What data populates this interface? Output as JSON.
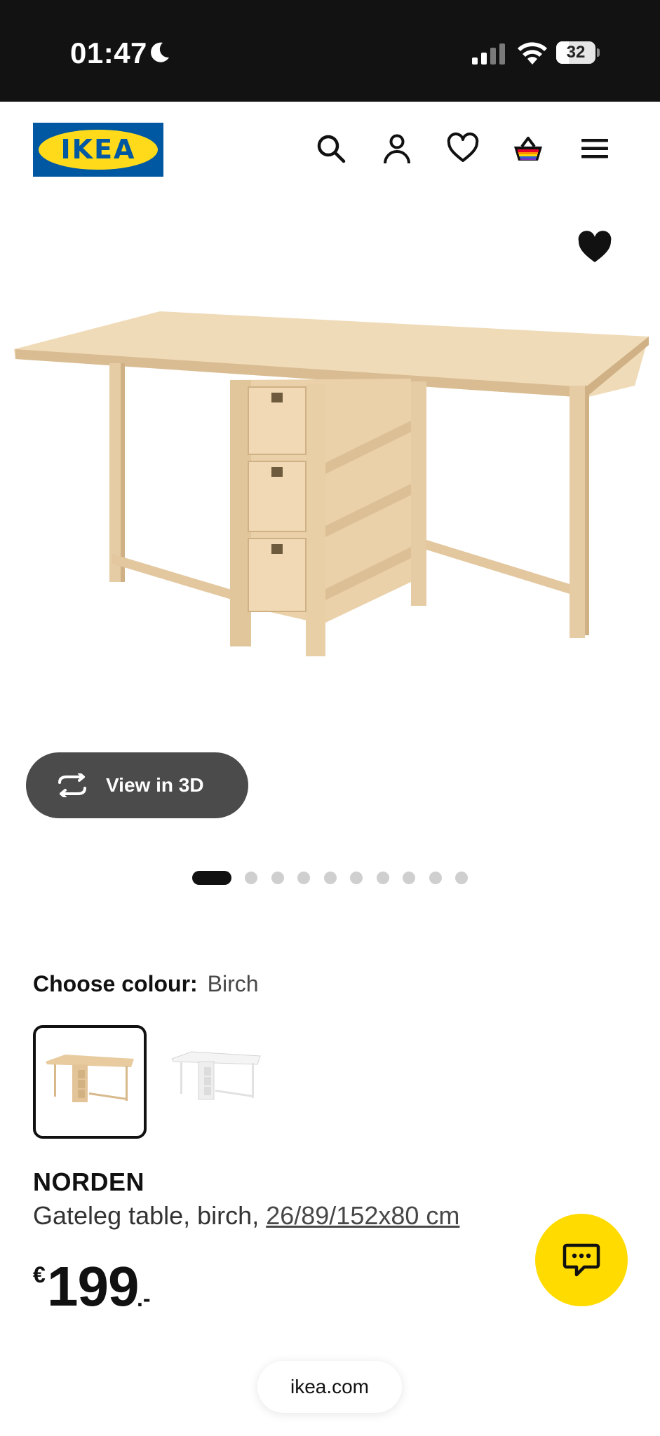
{
  "status_bar": {
    "time": "01:47",
    "battery": "32",
    "battery_level": 0.32
  },
  "header": {
    "logo_text": "IKEA",
    "icons": [
      "search-icon",
      "user-icon",
      "heart-icon",
      "shopping-basket-icon",
      "menu-icon"
    ]
  },
  "gallery": {
    "view_3d_label": "View in 3D",
    "image_count": 10,
    "active_image": 1
  },
  "colour": {
    "label": "Choose colour:",
    "value": "Birch",
    "options": [
      "Birch",
      "White"
    ]
  },
  "product": {
    "name": "NORDEN",
    "description": "Gateleg table, birch,",
    "dimensions": "26/89/152x80 cm",
    "price_currency": "€",
    "price_amount": "199",
    "price_suffix": ".-"
  },
  "browser": {
    "url": "ikea.com"
  },
  "colors": {
    "ikea_blue": "#0058a3",
    "ikea_yellow": "#ffda1a",
    "chat_yellow": "#ffdb00",
    "birch": "#ecd3ae"
  }
}
